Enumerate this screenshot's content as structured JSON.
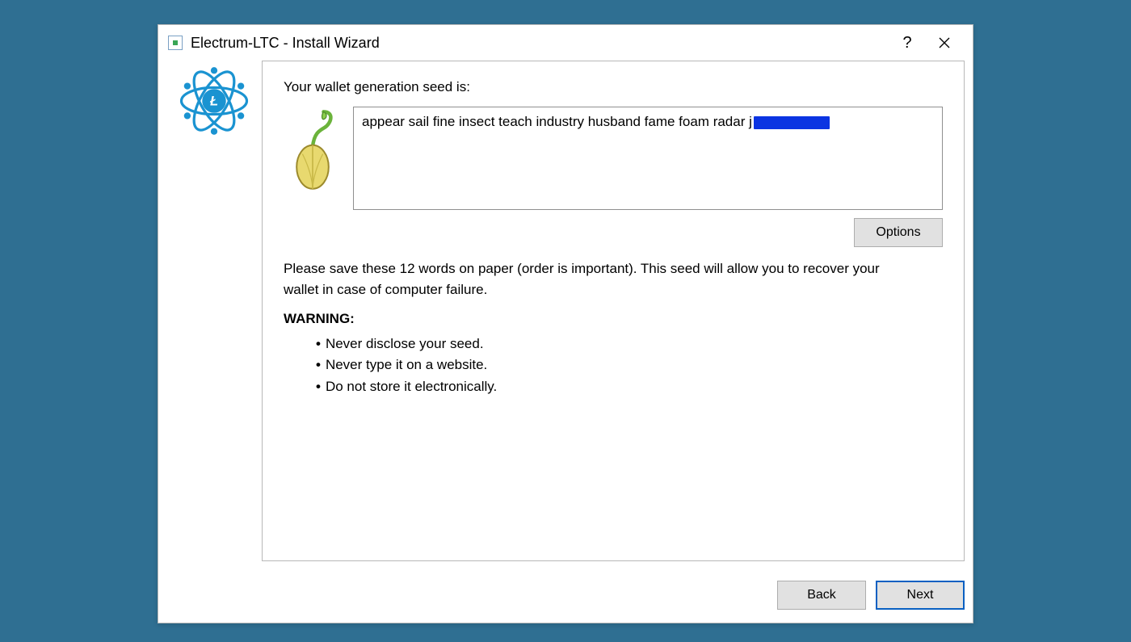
{
  "window": {
    "title": "Electrum-LTC  -  Install Wizard"
  },
  "content": {
    "lead": "Your wallet generation seed is:",
    "seed_visible": "appear sail fine insect teach industry husband fame foam radar j",
    "options_label": "Options",
    "instructions": "Please save these 12 words on paper (order is important). This seed will allow you to recover your wallet in case of computer failure.",
    "warning_heading": "WARNING:",
    "warnings": [
      "Never disclose your seed.",
      "Never type it on a website.",
      "Do not store it electronically."
    ]
  },
  "footer": {
    "back": "Back",
    "next": "Next"
  }
}
